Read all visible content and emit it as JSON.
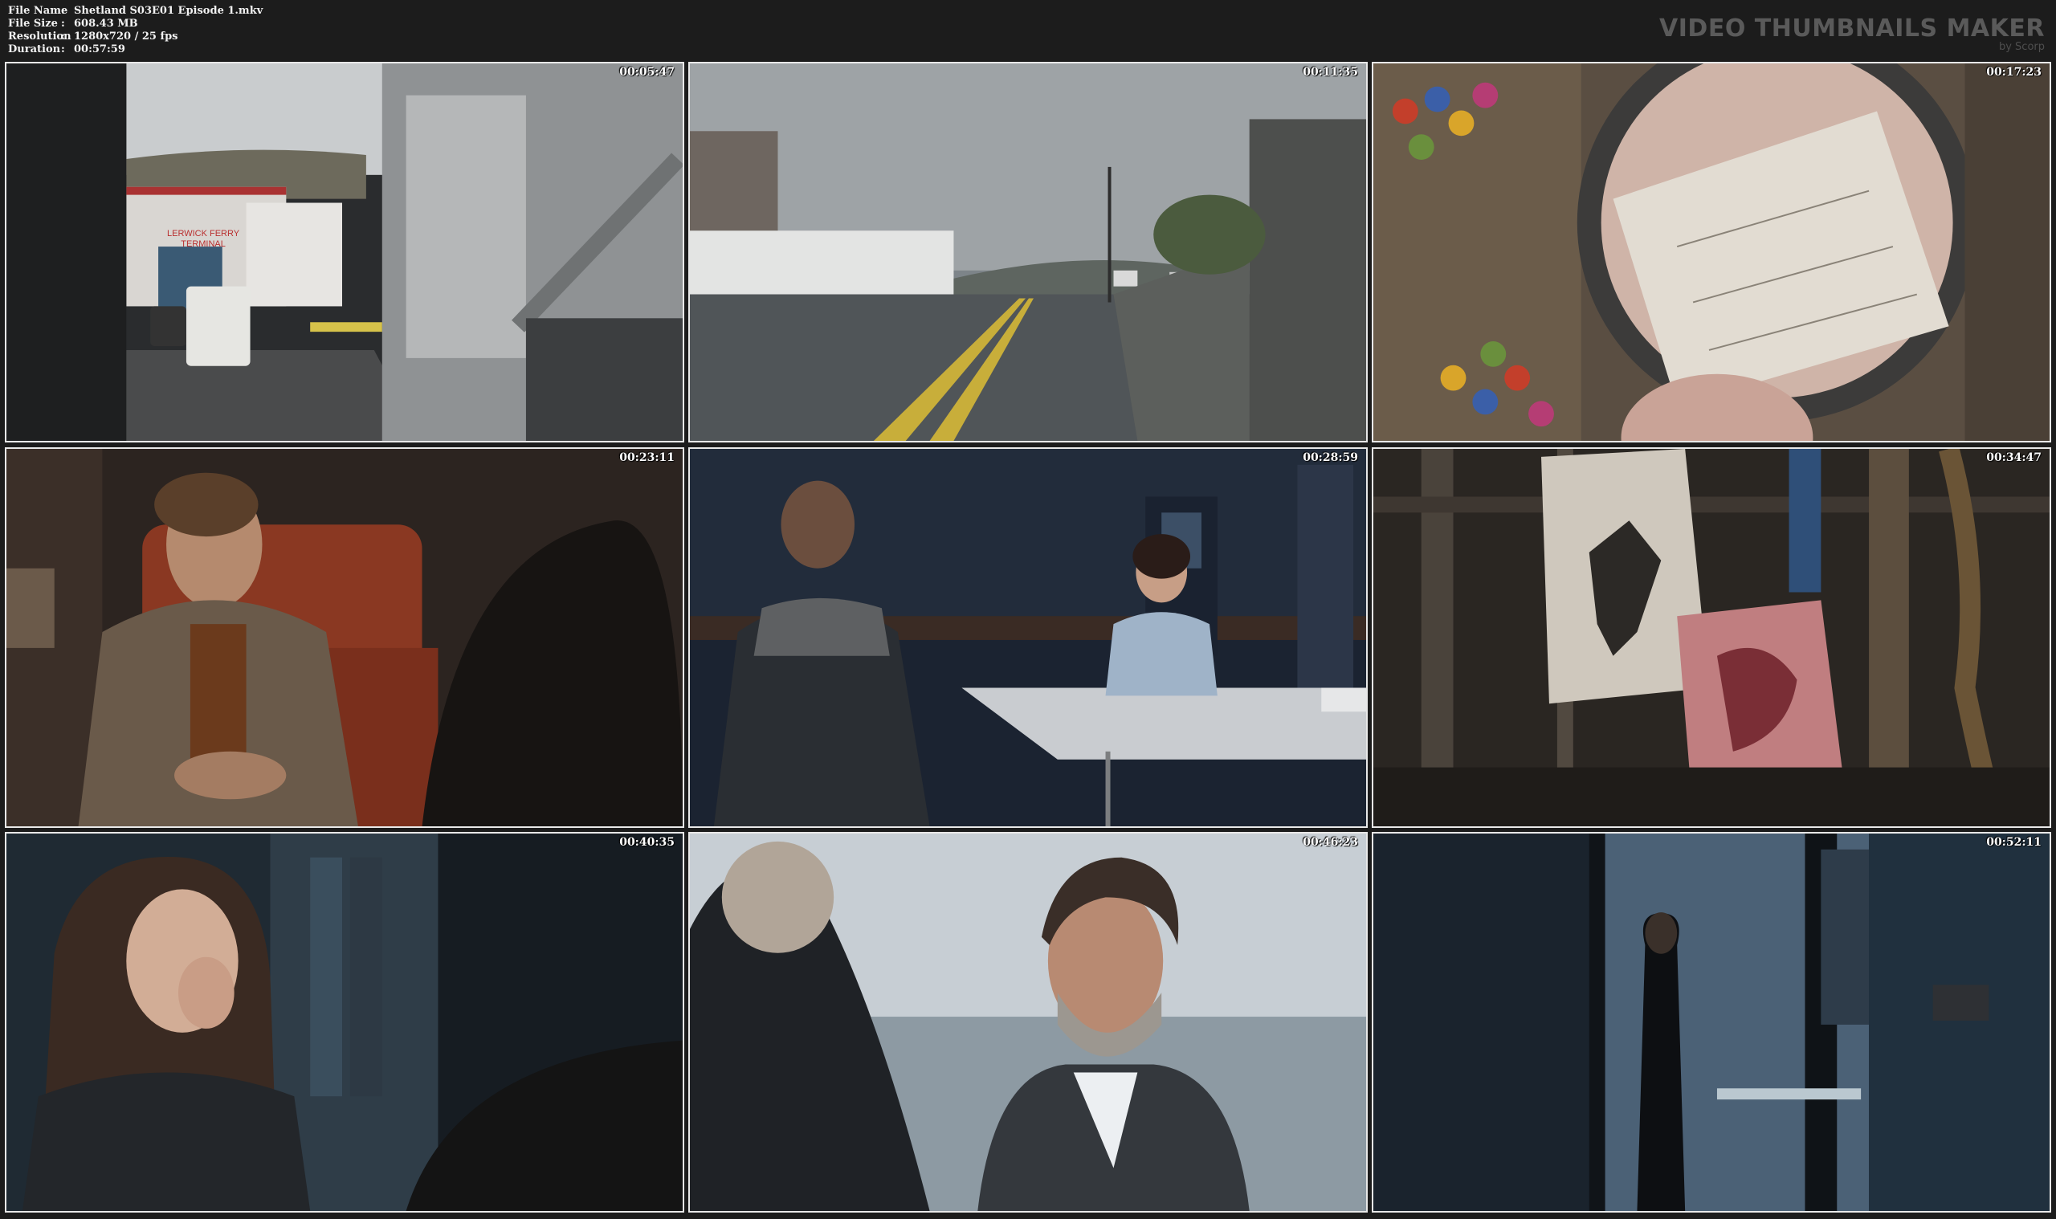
{
  "file_info": [
    {
      "label": "File Name",
      "value": "Shetland S03E01 Episode 1.mkv"
    },
    {
      "label": "File Size",
      "value": "608.43 MB"
    },
    {
      "label": "Resolution",
      "value": "1280x720 / 25 fps"
    },
    {
      "label": "Duration",
      "value": "00:57:59"
    }
  ],
  "separator": ":",
  "branding": {
    "title": "VIDEO THUMBNAILS MAKER",
    "subtitle": "by Scorp"
  },
  "thumbnails": [
    {
      "timestamp": "00:05:47",
      "sign_line1": "LERWICK FERRY",
      "sign_line2": "TERMINAL"
    },
    {
      "timestamp": "00:11:35"
    },
    {
      "timestamp": "00:17:23"
    },
    {
      "timestamp": "00:23:11"
    },
    {
      "timestamp": "00:28:59"
    },
    {
      "timestamp": "00:34:47"
    },
    {
      "timestamp": "00:40:35"
    },
    {
      "timestamp": "00:46:23"
    },
    {
      "timestamp": "00:52:11"
    }
  ]
}
